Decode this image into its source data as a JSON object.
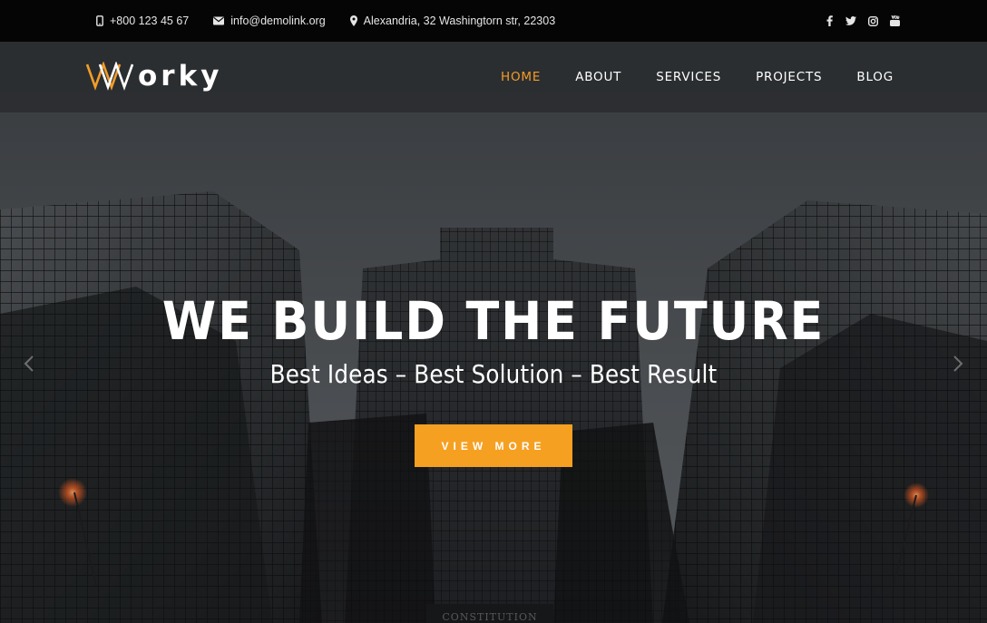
{
  "topbar": {
    "phone": "+800 123 45 67",
    "email": "info@demolink.org",
    "address": "Alexandria, 32 Washingtorn str, 22303",
    "social": [
      "facebook-icon",
      "twitter-icon",
      "instagram-icon",
      "youtube-icon"
    ]
  },
  "logo": {
    "text": "orky",
    "mark": "W"
  },
  "nav": {
    "items": [
      {
        "label": "HOME",
        "active": true
      },
      {
        "label": "ABOUT",
        "active": false
      },
      {
        "label": "SERVICES",
        "active": false
      },
      {
        "label": "PROJECTS",
        "active": false
      },
      {
        "label": "BLOG",
        "active": false
      }
    ]
  },
  "hero": {
    "headline": "WE BUILD THE FUTURE",
    "subline": "Best Ideas – Best Solution – Best Result",
    "cta": "VIEW MORE",
    "signage": "CONSTITUTION"
  },
  "colors": {
    "accent": "#f39c28",
    "button": "#f6a022",
    "topbar": "#050505"
  }
}
